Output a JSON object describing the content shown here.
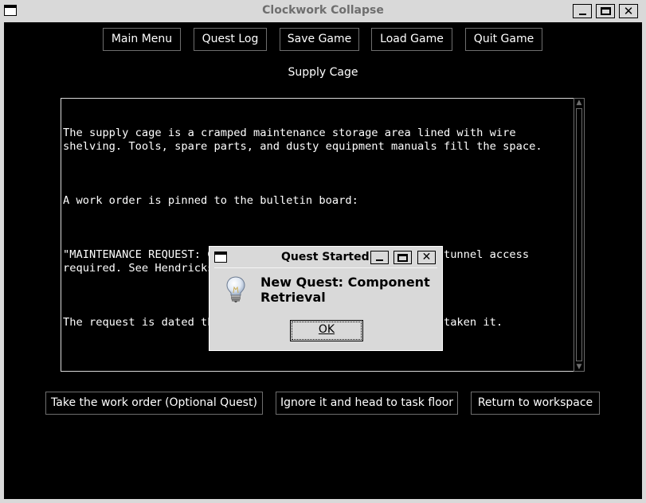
{
  "window": {
    "title": "Clockwork Collapse"
  },
  "menu": {
    "main_menu": "Main Menu",
    "quest_log": "Quest Log",
    "save_game": "Save Game",
    "load_game": "Load Game",
    "quit_game": "Quit Game"
  },
  "location": "Supply Cage",
  "story": {
    "paragraphs": [
      "The supply cage is a cramped maintenance storage area lined with wire shelving. Tools, spare parts, and dusty equipment manuals fill the space.",
      "A work order is pinned to the bulletin board:",
      "\"MAINTENANCE REQUEST: Component retrieval needed. Storage tunnel access required. See Hendricks if available.\"",
      "The request is dated three days ago. No one seems to have taken it."
    ]
  },
  "choices": {
    "take": "Take the work order (Optional Quest)",
    "ignore": "Ignore it and head to task floor",
    "return": "Return to workspace"
  },
  "dialog": {
    "title": "Quest Started",
    "message": "New Quest: Component Retrieval",
    "ok": "OK",
    "icon": "lightbulb-icon"
  },
  "colors": {
    "background": "#000000",
    "text": "#ffffff",
    "chrome": "#d9d9d9",
    "border": "#6e6e6e"
  }
}
